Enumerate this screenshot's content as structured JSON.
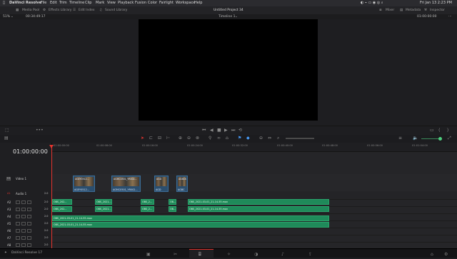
{
  "menubar": {
    "app": "DaVinci Resolve",
    "items": [
      "File",
      "Edit",
      "Trim",
      "Timeline",
      "Clip",
      "Mark",
      "View",
      "Playback",
      "Fusion",
      "Color",
      "Fairlight",
      "Workspace",
      "Help"
    ],
    "datetime": "Fri Jan 13  2:23 PM"
  },
  "toolbar": {
    "media_pool": "Media Pool",
    "effects_library": "Effects Library",
    "edit_index": "Edit Index",
    "sound_library": "Sound Library",
    "project_title": "Untitled Project 34",
    "mixer": "Mixer",
    "metadata": "Metadata",
    "inspector": "Inspector"
  },
  "viewer": {
    "zoom": "51%",
    "source_tc": "00:34:49:17",
    "timeline_name": "Timeline 1",
    "tc_right": "01:00:00:00"
  },
  "timeline": {
    "timecode": "01:00:00:00",
    "ruler_ticks": [
      "01:00:00:00",
      "01:00:08:00",
      "01:00:16:00",
      "01:00:24:00",
      "01:00:32:00",
      "01:00:40:00",
      "01:00:48:00",
      "01:00:56:00",
      "01:01:04:00"
    ],
    "tracks": [
      {
        "id": "V1",
        "name": "Video 1"
      },
      {
        "id": "A1",
        "name": "Audio 1",
        "level": "2.0"
      },
      {
        "id": "A2",
        "level": "2.0"
      },
      {
        "id": "A3",
        "level": "2.0"
      },
      {
        "id": "A4",
        "level": "2.0"
      },
      {
        "id": "A5",
        "level": "2.0"
      },
      {
        "id": "A6",
        "level": "2.0"
      },
      {
        "id": "A7",
        "level": "2.0"
      },
      {
        "id": "A8",
        "level": "2.0"
      }
    ],
    "video_clips": [
      {
        "label": "AGEY0512...",
        "lower": "AGEY0512..."
      },
      {
        "label": "AGMC0501_YR002...",
        "lower": "AGMC0501_YR002..."
      },
      {
        "label": "AGD",
        "lower": "AGD"
      },
      {
        "label": "AGBCK",
        "lower": "AGBC"
      }
    ],
    "audio_clips_a1": [
      "OBS_202...",
      "OBS_2021...",
      "OBS_2...",
      "OB...",
      "OBS_2021-03-01_21-14-55.mov"
    ],
    "audio_clips_a2": [
      "OBS_202...",
      "OBS_2021...",
      "OBS_2...",
      "OB...",
      "OBS_2021-03-01_21-14-55.mov"
    ],
    "audio_clip_a4": "OBS_2021-03-01_21-14-55.mov",
    "audio_clip_a5": "OBS_2021-03-01_21-14-55.mov"
  },
  "statusbar": {
    "app_version": "DaVinci Resolve 17"
  },
  "colors": {
    "accent_red": "#e3342f",
    "audio_clip": "#1f8a5a",
    "video_clip": "#2b4e6e"
  }
}
